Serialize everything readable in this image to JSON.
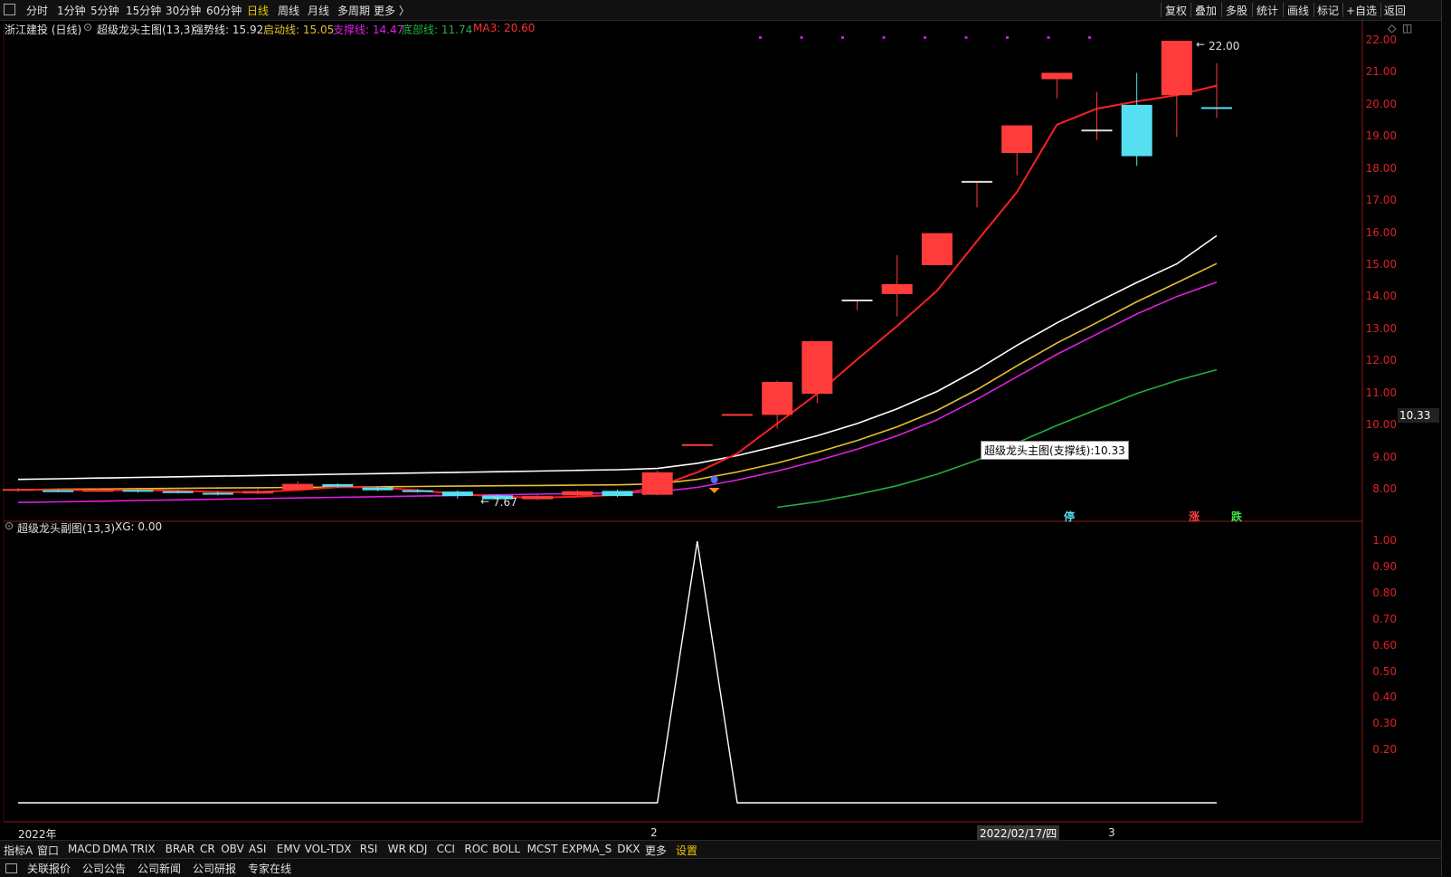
{
  "toolbar": {
    "periods": [
      "分时",
      "1分钟",
      "5分钟",
      "15分钟",
      "30分钟",
      "60分钟",
      "日线",
      "周线",
      "月线",
      "多周期",
      "更多 〉"
    ],
    "active_period": "日线",
    "right": [
      "复权",
      "叠加",
      "多股",
      "统计",
      "画线",
      "标记",
      "+自选",
      "返回"
    ]
  },
  "main_title": {
    "stock": "浙江建投 (日线)",
    "indicator": "超级龙头主图(13,3)",
    "strong": "强势线: 15.92",
    "start": "启动线: 15.05",
    "support": "支撑线: 14.47",
    "bottom": "底部线: 11.74",
    "ma3": "MA3: 20.60"
  },
  "sub_title": {
    "indicator": "超级龙头副图(13,3)",
    "xg": "XG: 0.00"
  },
  "colors": {
    "up": "#ff3b3b",
    "down": "#54e0f0",
    "strong": "#ffffff",
    "start": "#e8c030",
    "support": "#e020e0",
    "bottom": "#20b040",
    "ma3": "#ff2020",
    "axis": "#ee2222"
  },
  "price_axis": [
    "22.00",
    "21.00",
    "20.00",
    "19.00",
    "18.00",
    "17.00",
    "16.00",
    "15.00",
    "14.00",
    "13.00",
    "12.00",
    "11.00",
    "10.00",
    "9.00",
    "8.00"
  ],
  "sub_axis": [
    "1.00",
    "0.90",
    "0.80",
    "0.70",
    "0.60",
    "0.50",
    "0.40",
    "0.30",
    "0.20"
  ],
  "current_price": "10.33",
  "tooltip": "超级龙头主图(支撑线):10.33",
  "labels": {
    "high": "22.00",
    "low": "7.67",
    "year": "2022年",
    "month2": "2",
    "month3": "3",
    "date": "2022/02/17/四"
  },
  "signals": {
    "ting": "停",
    "zhang": "涨",
    "die": "跌"
  },
  "chart_data": {
    "type": "candlestick",
    "x_count": 30,
    "candles": [
      {
        "o": 7.97,
        "c": 8.02,
        "h": 8.05,
        "l": 7.93
      },
      {
        "o": 7.98,
        "c": 7.96,
        "h": 8.01,
        "l": 7.92
      },
      {
        "o": 7.97,
        "c": 7.99,
        "h": 8.04,
        "l": 7.94
      },
      {
        "o": 7.99,
        "c": 7.96,
        "h": 8.02,
        "l": 7.91
      },
      {
        "o": 7.95,
        "c": 7.92,
        "h": 7.98,
        "l": 7.88
      },
      {
        "o": 7.9,
        "c": 7.86,
        "h": 7.95,
        "l": 7.82
      },
      {
        "o": 7.88,
        "c": 7.96,
        "h": 8.02,
        "l": 7.86
      },
      {
        "o": 8.0,
        "c": 8.18,
        "h": 8.26,
        "l": 7.99
      },
      {
        "o": 8.17,
        "c": 8.09,
        "h": 8.2,
        "l": 8.05
      },
      {
        "o": 8.07,
        "c": 7.98,
        "h": 8.1,
        "l": 7.95
      },
      {
        "o": 7.98,
        "c": 7.94,
        "h": 8.02,
        "l": 7.9
      },
      {
        "o": 7.94,
        "c": 7.8,
        "h": 7.98,
        "l": 7.72
      },
      {
        "o": 7.82,
        "c": 7.7,
        "h": 7.86,
        "l": 7.67
      },
      {
        "o": 7.7,
        "c": 7.8,
        "h": 7.84,
        "l": 7.67
      },
      {
        "o": 7.82,
        "c": 7.95,
        "h": 7.99,
        "l": 7.79
      },
      {
        "o": 7.96,
        "c": 7.8,
        "h": 8.0,
        "l": 7.77
      },
      {
        "o": 7.84,
        "c": 8.54,
        "h": 8.6,
        "l": 7.82
      },
      {
        "o": 9.39,
        "c": 9.39,
        "h": 9.39,
        "l": 9.39
      },
      {
        "o": 10.33,
        "c": 10.33,
        "h": 10.33,
        "l": 10.33
      },
      {
        "o": 10.33,
        "c": 11.36,
        "h": 11.4,
        "l": 9.9
      },
      {
        "o": 10.99,
        "c": 12.63,
        "h": 12.63,
        "l": 10.7
      },
      {
        "o": 13.9,
        "c": 13.9,
        "h": 13.9,
        "l": 13.6
      },
      {
        "o": 14.1,
        "c": 14.41,
        "h": 15.31,
        "l": 13.4
      },
      {
        "o": 15.0,
        "c": 16.0,
        "h": 16.0,
        "l": 15.0
      },
      {
        "o": 17.6,
        "c": 17.6,
        "h": 17.6,
        "l": 16.8
      },
      {
        "o": 18.5,
        "c": 19.36,
        "h": 19.36,
        "l": 17.8
      },
      {
        "o": 20.8,
        "c": 21.0,
        "h": 21.0,
        "l": 20.2
      },
      {
        "o": 19.2,
        "c": 19.2,
        "h": 20.4,
        "l": 18.9
      },
      {
        "o": 20.0,
        "c": 18.4,
        "h": 21.0,
        "l": 18.1
      },
      {
        "o": 20.3,
        "c": 22.0,
        "h": 22.0,
        "l": 19.0
      },
      {
        "o": 19.9,
        "c": 19.9,
        "h": 21.3,
        "l": 19.6
      }
    ],
    "series": [
      {
        "name": "强势线",
        "values": [
          8.32,
          8.34,
          8.36,
          8.38,
          8.4,
          8.42,
          8.44,
          8.46,
          8.48,
          8.5,
          8.52,
          8.54,
          8.56,
          8.58,
          8.6,
          8.62,
          8.66,
          8.82,
          9.06,
          9.36,
          9.68,
          10.06,
          10.52,
          11.06,
          11.74,
          12.5,
          13.2,
          13.84,
          14.46,
          15.04,
          15.92
        ]
      },
      {
        "name": "启动线",
        "values": [
          8.0,
          8.01,
          8.02,
          8.03,
          8.04,
          8.05,
          8.06,
          8.07,
          8.08,
          8.09,
          8.1,
          8.11,
          8.12,
          8.13,
          8.14,
          8.15,
          8.18,
          8.32,
          8.55,
          8.83,
          9.16,
          9.53,
          9.96,
          10.47,
          11.12,
          11.86,
          12.57,
          13.21,
          13.86,
          14.45,
          15.05
        ]
      },
      {
        "name": "支撑线",
        "values": [
          7.6,
          7.62,
          7.64,
          7.66,
          7.68,
          7.7,
          7.72,
          7.74,
          7.76,
          7.78,
          7.8,
          7.82,
          7.84,
          7.86,
          7.88,
          7.9,
          7.93,
          8.07,
          8.3,
          8.58,
          8.9,
          9.26,
          9.68,
          10.18,
          10.82,
          11.52,
          12.22,
          12.85,
          13.48,
          14.02,
          14.47
        ]
      },
      {
        "name": "底部线",
        "values": [
          null,
          null,
          null,
          null,
          null,
          null,
          null,
          null,
          null,
          null,
          null,
          null,
          null,
          null,
          null,
          null,
          null,
          null,
          null,
          7.45,
          7.62,
          7.85,
          8.12,
          8.48,
          8.92,
          9.46,
          10.0,
          10.5,
          11.0,
          11.4,
          11.74
        ]
      },
      {
        "name": "MA3",
        "values": [
          8.0,
          7.99,
          7.98,
          7.99,
          7.97,
          7.93,
          7.92,
          7.99,
          8.08,
          8.07,
          7.98,
          7.87,
          7.78,
          7.75,
          7.78,
          7.84,
          8.09,
          8.54,
          9.13,
          10.06,
          10.99,
          12.06,
          13.1,
          14.2,
          15.75,
          17.28,
          19.38,
          19.88,
          20.11,
          20.3,
          20.6
        ]
      }
    ],
    "sub_series": {
      "name": "XG",
      "values": [
        0,
        0,
        0,
        0,
        0,
        0,
        0,
        0,
        0,
        0,
        0,
        0,
        0,
        0,
        0,
        0,
        0,
        1,
        0,
        0,
        0,
        0,
        0,
        0,
        0,
        0,
        0,
        0,
        0,
        0,
        0
      ]
    },
    "ylim": [
      7.4,
      22.2
    ],
    "sub_ylim": [
      0,
      1
    ]
  }
}
